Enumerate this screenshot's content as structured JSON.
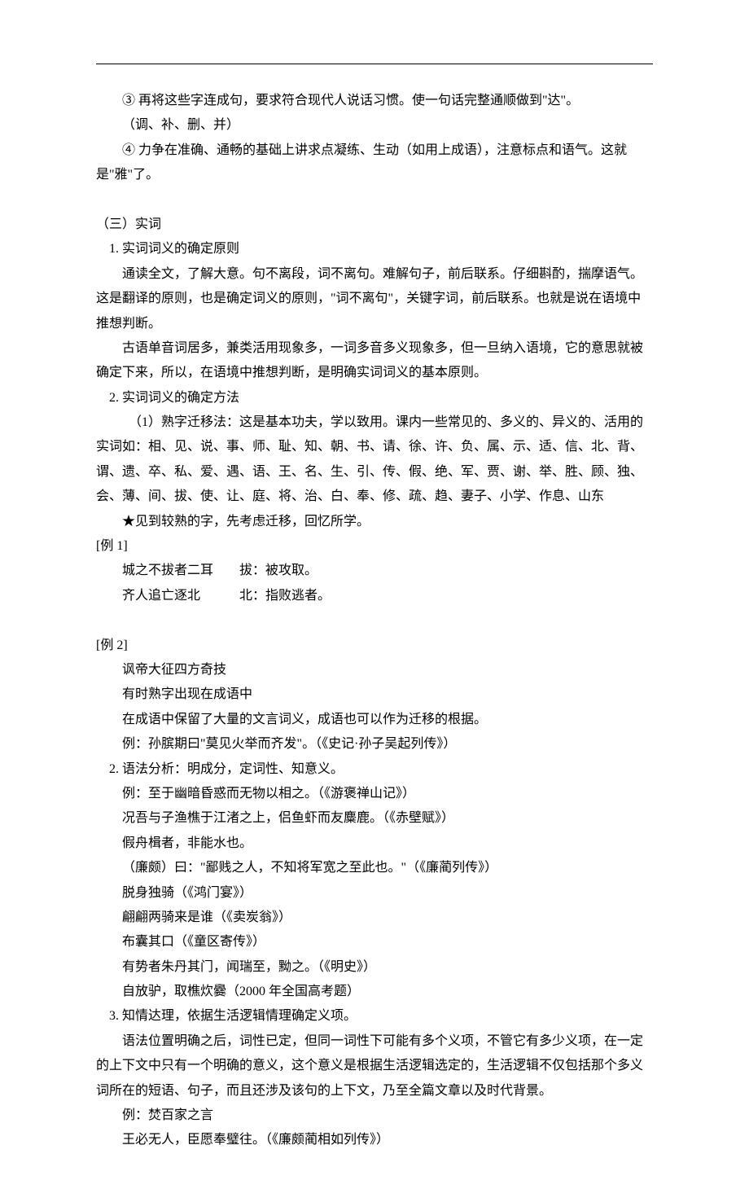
{
  "line1": "③ 再将这些字连成句，要求符合现代人说话习惯。使一句话完整通顺做到\"达\"。",
  "line2": "（调、补、删、并）",
  "line3": "④ 力争在准确、通畅的基础上讲求点凝练、生动（如用上成语），注意标点和语气。这就是\"雅\"了。",
  "sec3_title": "（三）实词",
  "sec3_1_title": "　1. 实词词义的确定原则",
  "sec3_1_p1": "通读全文，了解大意。句不离段，词不离句。难解句子，前后联系。仔细斟酌，揣摩语气。这是翻译的原则，也是确定词义的原则，\"词不离句\"，关键字词，前后联系。也就是说在语境中推想判断。",
  "sec3_1_p2": "古语单音词居多，兼类活用现象多，一词多音多义现象多，但一旦纳入语境，它的意思就被确定下来，所以，在语境中推想判断，是明确实词词义的基本原则。",
  "sec3_2_title": "　2. 实词词义的确定方法",
  "sec3_2_p1": "　（1）熟字迁移法：这是基本功夫，学以致用。课内一些常见的、多义的、异义的、活用的实词如：相、见、说、事、师、耻、知、朝、书、请、徐、许、负、属、示、适、信、北、背、谓、遗、卒、私、爱、遇、语、王、名、生、引、传、假、绝、军、贾、谢、举、胜、顾、独、会、薄、间、拔、使、让、庭、将、治、白、奉、修、疏、趋、妻子、小学、作息、山东",
  "sec3_2_star": "★见到较熟的字，先考虑迁移，回忆所学。",
  "ex1_label": "[例 1]",
  "ex1_l1": "城之不拔者二耳　　拔：被攻取。",
  "ex1_l2": "齐人追亡逐北　　　北：指败逃者。",
  "ex2_label": "[例 2]",
  "ex2_l1": "讽帝大征四方奇技",
  "ex2_l2": "有时熟字出现在成语中",
  "ex2_l3": "在成语中保留了大量的文言词义，成语也可以作为迁移的根据。",
  "ex2_l4": "例：孙膑期曰\"莫见火举而齐发\"。（《史记·孙子吴起列传》）",
  "sec3_2b_title": "　2. 语法分析：明成分，定词性、知意义。",
  "g1": "例：至于幽暗昏惑而无物以相之。（《游褒禅山记》）",
  "g2": "况吾与子渔樵于江渚之上，侣鱼虾而友麋鹿。（《赤壁赋》）",
  "g3": "假舟楫者，非能水也。",
  "g4": "（廉颇）曰：\"鄙贱之人，不知将军宽之至此也。\"（《廉蔺列传》）",
  "g5": "脱身独骑（《鸿门宴》）",
  "g6": "翩翩两骑来是谁（《卖炭翁》）",
  "g7": "布囊其口（《童区寄传》）",
  "g8": "有势者朱丹其门，闻瑞至，黝之。（《明史》）",
  "g9": "自放驴，取樵炊爨（2000 年全国高考题）",
  "sec3_3_title": "　3. 知情达理，依据生活逻辑情理确定义项。",
  "sec3_3_p": "语法位置明确之后，词性已定，但同一词性下可能有多个义项，不管它有多少义项，在一定的上下文中只有一个明确的意义，这个意义是根据生活逻辑选定的，生活逻辑不仅包括那个多义词所在的短语、句子，而且还涉及该句的上下文，乃至全篇文章以及时代背景。",
  "sec3_3_e1": "例：焚百家之言",
  "sec3_3_e2": "王必无人，臣愿奉璧往。（《廉颇蔺相如列传》）"
}
